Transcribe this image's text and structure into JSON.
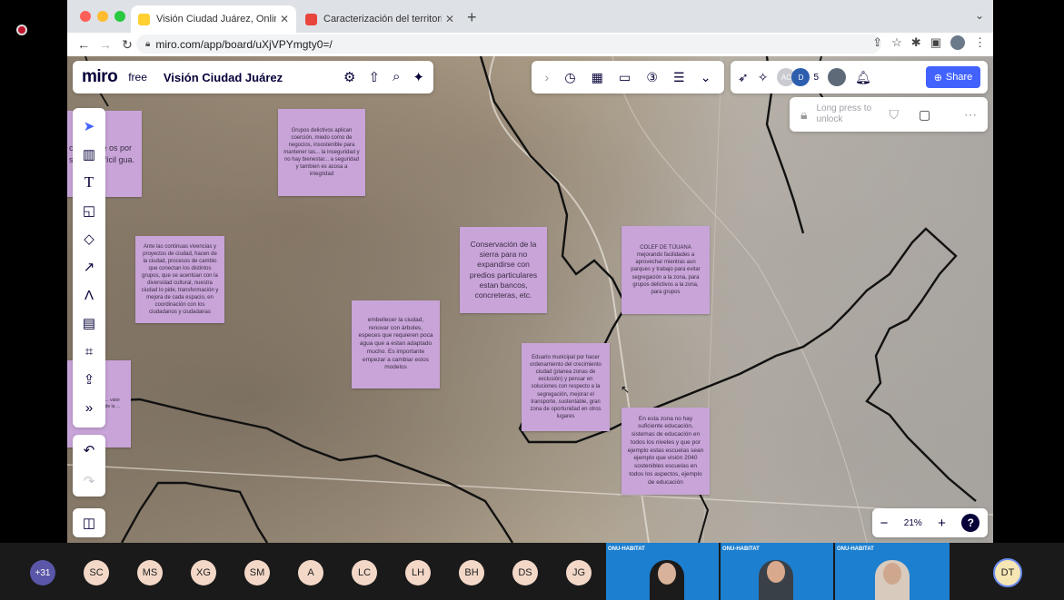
{
  "browser": {
    "tabs": [
      {
        "title": "Visión Ciudad Juárez, Online W",
        "active": true,
        "favicon_color": "#ffd02f"
      },
      {
        "title": "Caracterización del territorio_",
        "active": false,
        "favicon_color": "#e8453c"
      }
    ],
    "new_tab_symbol": "+",
    "url": "miro.com/app/board/uXjVPYmgty0=/"
  },
  "miro": {
    "logo": "miro",
    "plan": "free",
    "board_title": "Visión Ciudad Juárez",
    "online_count": "5",
    "avatar_initial": "D",
    "avatar_initial_2": "AC",
    "share_label": "Share",
    "lock_text": "Long press to unlock",
    "zoom_level": "21%",
    "help_label": "?"
  },
  "stickies": [
    {
      "id": "s-left-top",
      "text": "cas mente os por s de es difícil gua."
    },
    {
      "id": "s1",
      "text": "Grupos delictivos aplican coerción, miedo como de negocios, insostenible para mantener las... la inseguridad y no hay bienestar... a seguridad y tambien es acosa a integridad"
    },
    {
      "id": "s2",
      "text": "Ante las continuas vivencias y proyectos de ciudad, hacen de la ciudad, procesos de cambio que conectan los distintos grupos, que se acentúan con la diversidad cultural, nuestra ciudad lo pide, transformación y mejora de cada espacio, en coordinación con los ciudadanos y ciudadanas"
    },
    {
      "id": "s3",
      "text": "Conservación de la sierra para no expandirse con predios particulares estan bancos, concreteras, etc."
    },
    {
      "id": "s4",
      "text": "COLEF DE TIJUANA mejorando facilidades a aprovechar mientras aun parques y trabajo para evitar segregación a la zona, para grupos delictivos a la zona, para grupos"
    },
    {
      "id": "s5",
      "text": "embellecer la ciudad, renovar con árboles, especes que requieren poca agua que a estan adaptado mucho. Es importante empezar a cambiar estos modelos"
    },
    {
      "id": "s6",
      "text": "Eduarlo municipal por hacer ordenamiento del crecimiento ciudad (planea zonas de exclusión) y pensar en soluciones con respecto a la segregación, mejorar el transporte, sustentable, gran zona de oportunidad en otros lugares"
    },
    {
      "id": "s7",
      "text": "En esta zona no hay suficiente educación, sistemas de educación en todos los niveles y que por ejemplo estas escuelas sean ejemplo que visión 2040 sostenibles escuelas en todos los aspectos, ejemplo de educación"
    },
    {
      "id": "s-left-bottom",
      "text": "s y ... que les ... valor ... y que ... de la ..."
    }
  ],
  "meeting": {
    "more_count": "+31",
    "participants": [
      "SC",
      "MS",
      "XG",
      "SM",
      "A",
      "LC",
      "LH",
      "BH",
      "DS",
      "JG"
    ],
    "video_banner": "ONU-HABITAT",
    "self_initials": "DT"
  }
}
